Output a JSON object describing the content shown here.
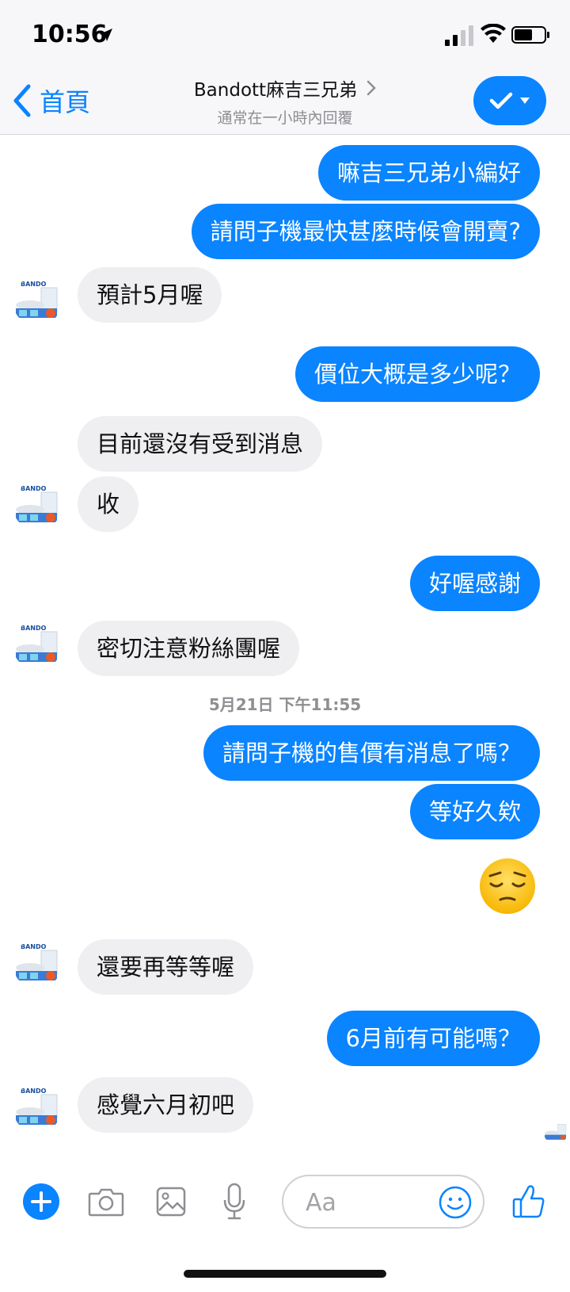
{
  "status_bar": {
    "time": "10:56",
    "icons": [
      "location-arrow-icon",
      "signal-icon",
      "wifi-icon",
      "battery-icon"
    ]
  },
  "header": {
    "back_label": "首頁",
    "title": "Bandott麻吉三兄弟",
    "subtitle": "通常在一小時內回覆",
    "accent_color": "#0a84ff"
  },
  "messages": {
    "m1": "嘛吉三兄弟小編好",
    "m2": "請問子機最快甚麼時候會開賣?",
    "m3": "預計5月喔",
    "m4": "價位大概是多少呢？",
    "m5": "目前還沒有受到消息",
    "m6": "收",
    "m7": "好喔感謝",
    "m8": "密切注意粉絲團喔",
    "timestamp": "5月21日 下午11:55",
    "m9": "請問子機的售價有消息了嗎？",
    "m10": "等好久欸",
    "m11_emoji": "pensive-face-emoji",
    "m12": "還要再等等喔",
    "m13": "6月前有可能嗎？",
    "m14": "感覺六月初吧"
  },
  "avatar": {
    "brand_text": "BANDO"
  },
  "composer": {
    "placeholder": "Aa"
  }
}
